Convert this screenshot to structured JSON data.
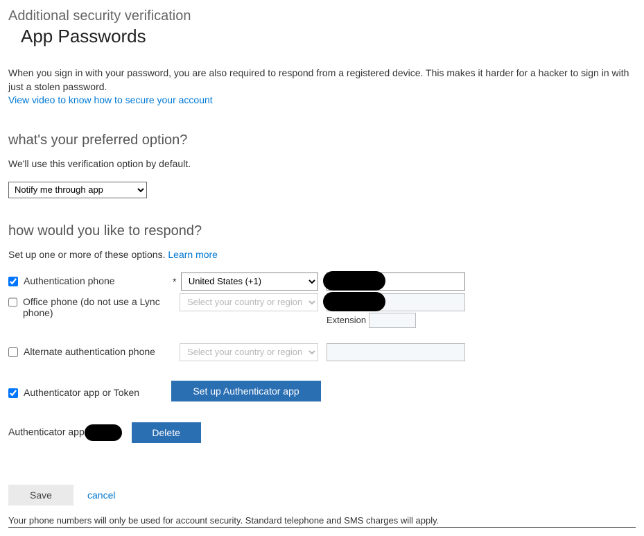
{
  "tabs": {
    "verification": "Additional security verification",
    "appPasswords": "App Passwords"
  },
  "intro": {
    "text": "When you sign in with your password, you are also required to respond from a registered device. This makes it harder for a hacker to sign in with just a stolen password.",
    "videoLink": "View video to know how to secure your account"
  },
  "preferred": {
    "heading": "what's your preferred option?",
    "sub": "We'll use this verification option by default.",
    "selected": "Notify me through app"
  },
  "respond": {
    "heading": "how would you like to respond?",
    "subPrefix": "Set up one or more of these options. ",
    "learnMore": "Learn more",
    "requiredMark": "*",
    "options": {
      "authPhone": {
        "label": "Authentication phone",
        "checked": true,
        "country": "United States (+1)",
        "phone": ""
      },
      "officePhone": {
        "label": "Office phone (do not use a Lync phone)",
        "checked": false,
        "countryPlaceholder": "Select your country or region",
        "phone": "",
        "extensionLabel": "Extension",
        "extension": ""
      },
      "altPhone": {
        "label": "Alternate authentication phone",
        "checked": false,
        "countryPlaceholder": "Select your country or region",
        "phone": ""
      },
      "authApp": {
        "label": "Authenticator app or Token",
        "checked": true,
        "setupButton": "Set up Authenticator app"
      }
    }
  },
  "registered": {
    "label": "Authenticator app",
    "deleteButton": "Delete"
  },
  "actions": {
    "save": "Save",
    "cancel": "cancel"
  },
  "footer": "Your phone numbers will only be used for account security. Standard telephone and SMS charges will apply."
}
